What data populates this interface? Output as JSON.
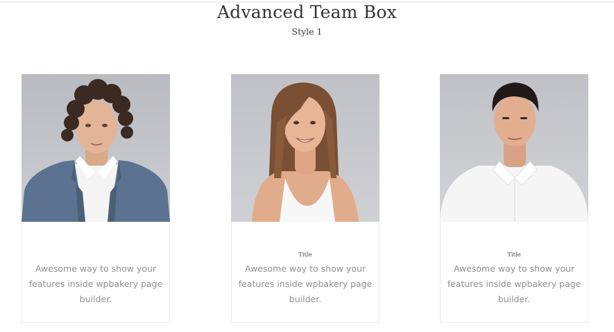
{
  "header": {
    "title": "Advanced Team Box",
    "subtitle": "Style 1"
  },
  "cards": [
    {
      "photo": "man-curly-hair-blue-blazer-portrait",
      "title": "",
      "description": "Awesome way to show your features inside wpbakery page builder."
    },
    {
      "photo": "smiling-woman-white-tank-top-portrait",
      "title": "Title",
      "description": "Awesome way to show your features inside wpbakery page builder."
    },
    {
      "photo": "man-short-dark-hair-white-shirt-portrait",
      "title": "Title",
      "description": "Awesome way to show your features inside wpbakery page builder."
    }
  ],
  "colors": {
    "heading": "#333333",
    "description": "#8f8f8f",
    "card_border": "#ececec",
    "photo_background": "#c3c4c9"
  }
}
